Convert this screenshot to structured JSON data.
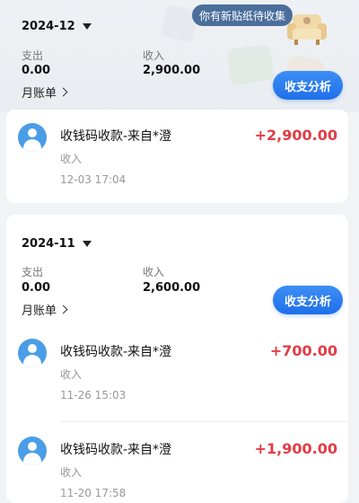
{
  "sticker_banner": {
    "label": "你有新贴纸待收集"
  },
  "months": [
    {
      "month": "2024-12",
      "expense_label": "支出",
      "expense_value": "0.00",
      "income_label": "收入",
      "income_value": "2,900.00",
      "bill_link": "月账单",
      "analysis_button": "收支分析",
      "transactions": [
        {
          "title": "收钱码收款-来自*澄",
          "type": "收入",
          "time": "12-03 17:04",
          "amount": "+2,900.00"
        }
      ]
    },
    {
      "month": "2024-11",
      "expense_label": "支出",
      "expense_value": "0.00",
      "income_label": "收入",
      "income_value": "2,600.00",
      "bill_link": "月账单",
      "analysis_button": "收支分析",
      "transactions": [
        {
          "title": "收钱码收款-来自*澄",
          "type": "收入",
          "time": "11-26 15:03",
          "amount": "+700.00"
        },
        {
          "title": "收钱码收款-来自*澄",
          "type": "收入",
          "time": "11-20 17:58",
          "amount": "+1,900.00"
        }
      ]
    }
  ],
  "colors": {
    "accent": "#1f6fea",
    "income_amount": "#e33b45",
    "avatar": "#4a9de6"
  },
  "icons": {
    "dropdown": "caret-down-icon",
    "bill_link": "chevron-right-icon",
    "avatar": "user-avatar-icon",
    "sticker": "sofa-sticker-icon"
  }
}
